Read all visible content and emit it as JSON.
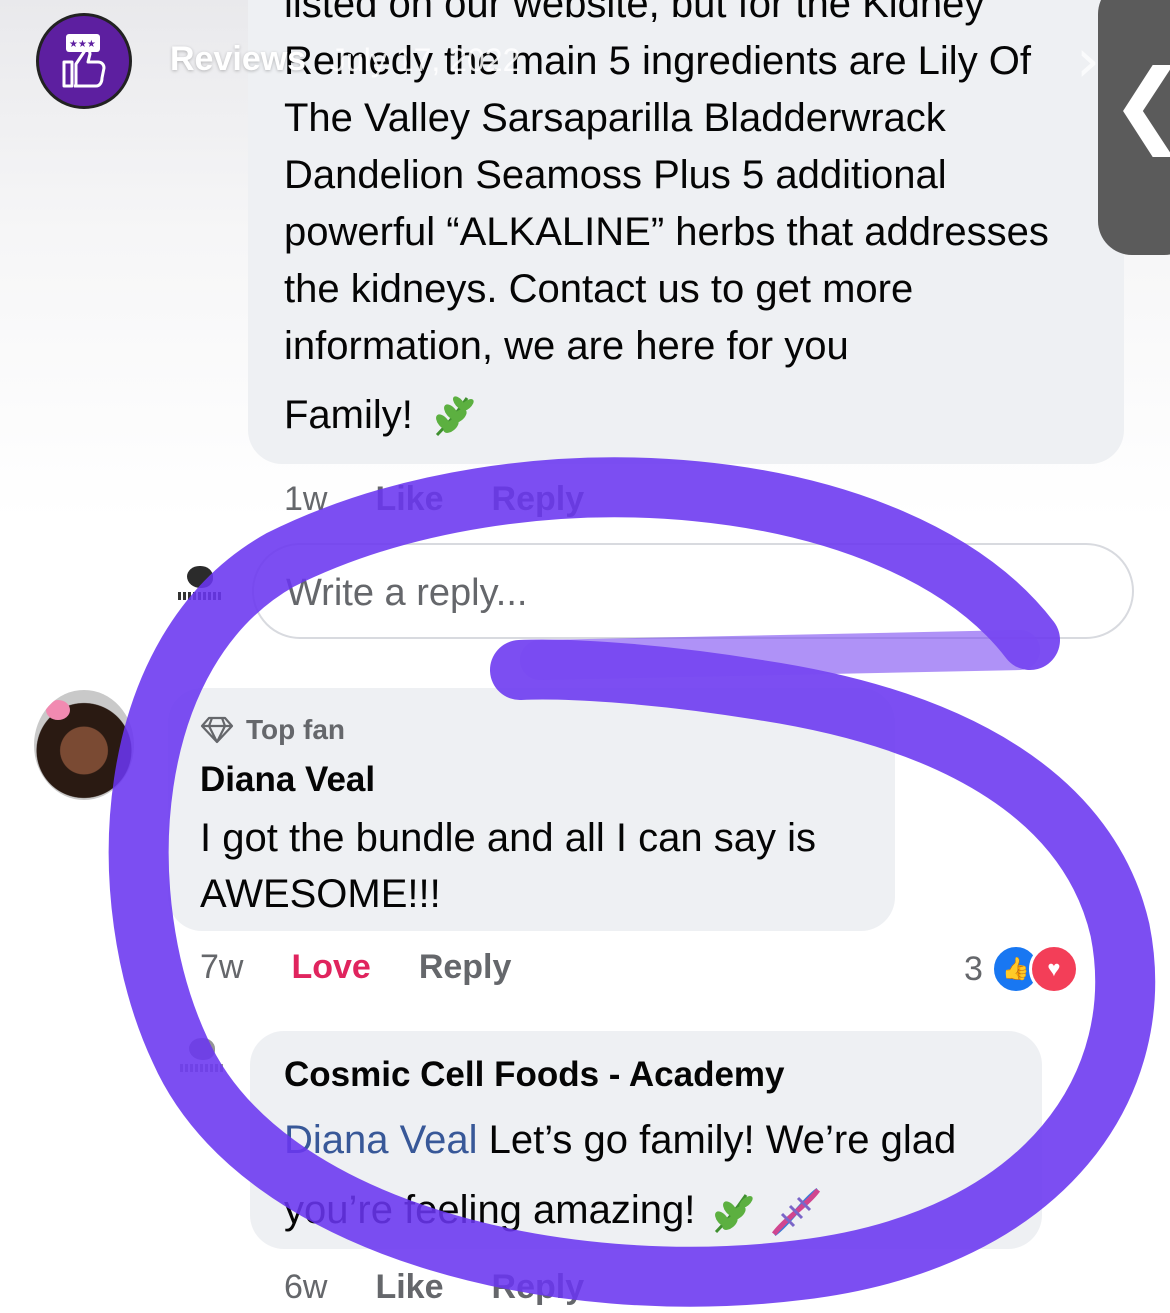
{
  "header": {
    "title": "Reviews",
    "date": "July 17, 2022"
  },
  "comment1": {
    "text": "listed on our website, but for the Kidney Remedy the main 5 ingredients are Lily Of The Valley Sarsaparilla Bladderwrack Dandelion Seamoss Plus 5 additional powerful “ALKALINE” herbs that addresses the kidneys. Contact us to get more information, we are here for you",
    "family": "Family!",
    "time": "1w",
    "like": "Like",
    "reply": "Reply"
  },
  "reply_input": {
    "placeholder": "Write a reply..."
  },
  "comment2": {
    "badge": "Top fan",
    "author": "Diana Veal",
    "text": "I got the bundle and all I can say is AWESOME!!!",
    "time": "7w",
    "reaction_action": "Love",
    "reply": "Reply",
    "reaction_count": "3"
  },
  "comment3": {
    "author": "Cosmic Cell Foods - Academy",
    "mention": "Diana Veal",
    "text_part1": " Let’s go family! We’re glad",
    "text_part2": "you’re feeling amazing!",
    "time": "6w",
    "like": "Like",
    "reply": "Reply"
  },
  "colors": {
    "scribble": "#6a35f0",
    "love": "#e0245e",
    "mention": "#385898",
    "page_avatar": "#5d1fa0"
  },
  "icons": [
    "thumbs-up-icon",
    "diamond-icon",
    "herb-icon",
    "dna-icon",
    "like-reaction-icon",
    "love-reaction-icon",
    "back-chevron-icon"
  ]
}
